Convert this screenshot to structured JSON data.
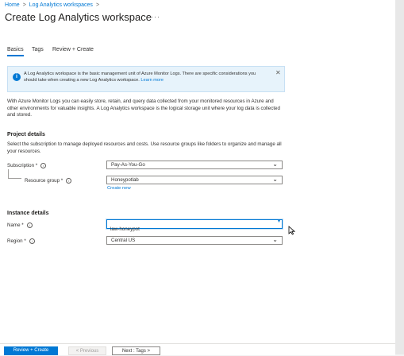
{
  "breadcrumb": [
    "Home",
    "Log Analytics workspaces"
  ],
  "page": {
    "title": "Create Log Analytics workspace",
    "more": "···"
  },
  "tabs": [
    {
      "label": "Basics",
      "active": true
    },
    {
      "label": "Tags",
      "active": false
    },
    {
      "label": "Review + Create",
      "active": false
    }
  ],
  "info": {
    "text": "A Log Analytics workspace is the basic management unit of Azure Monitor Logs. There are specific considerations you should take when creating a new Log Analytics workspace.",
    "link": "Learn more",
    "close": "✕"
  },
  "description": "With Azure Monitor Logs you can easily store, retain, and query data collected from your monitored resources in Azure and other environments for valuable insights. A Log Analytics workspace is the logical storage unit where your log data is collected and stored.",
  "project": {
    "heading": "Project details",
    "text": "Select the subscription to manage deployed resources and costs. Use resource groups like folders to organize and manage all your resources.",
    "subscription_label": "Subscription *",
    "subscription_value": "Pay-As-You-Go",
    "resource_group_label": "Resource group *",
    "resource_group_value": "Honeypotlab",
    "create_new": "Create new"
  },
  "instance": {
    "heading": "Instance details",
    "name_label": "Name *",
    "name_value": "law-honeypot",
    "region_label": "Region *",
    "region_value": "Central US"
  },
  "footer": {
    "review_create": "Review + Create",
    "previous": "< Previous",
    "next": "Next : Tags >"
  },
  "colors": {
    "accent": "#0078d4",
    "info_bg": "#e7f3fb"
  }
}
